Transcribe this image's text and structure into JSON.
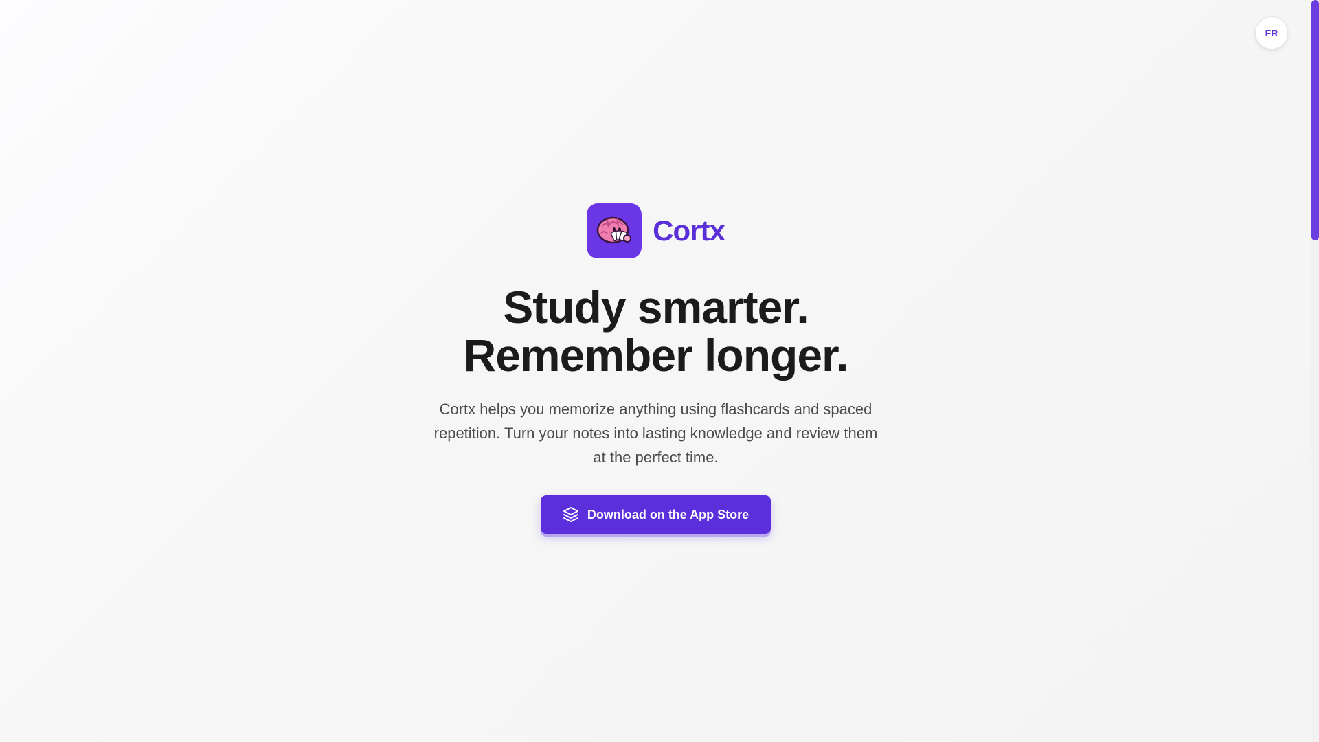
{
  "language_toggle": {
    "label": "FR"
  },
  "brand": {
    "name": "Cortx",
    "logo_icon": "brain-holding-flashcards-icon"
  },
  "hero": {
    "headline_line1": "Study smarter.",
    "headline_line2": "Remember longer.",
    "description": "Cortx helps you memorize anything using flashcards and spaced repetition. Turn your notes into lasting knowledge and review them at the perfect time."
  },
  "cta": {
    "label": "Download on the App Store",
    "icon": "stack-layers-icon"
  },
  "colors": {
    "accent": "#5b30dc",
    "brand_text": "#5b2fd8",
    "headline": "#1b1b1b",
    "body_text": "#4a4a4f"
  }
}
